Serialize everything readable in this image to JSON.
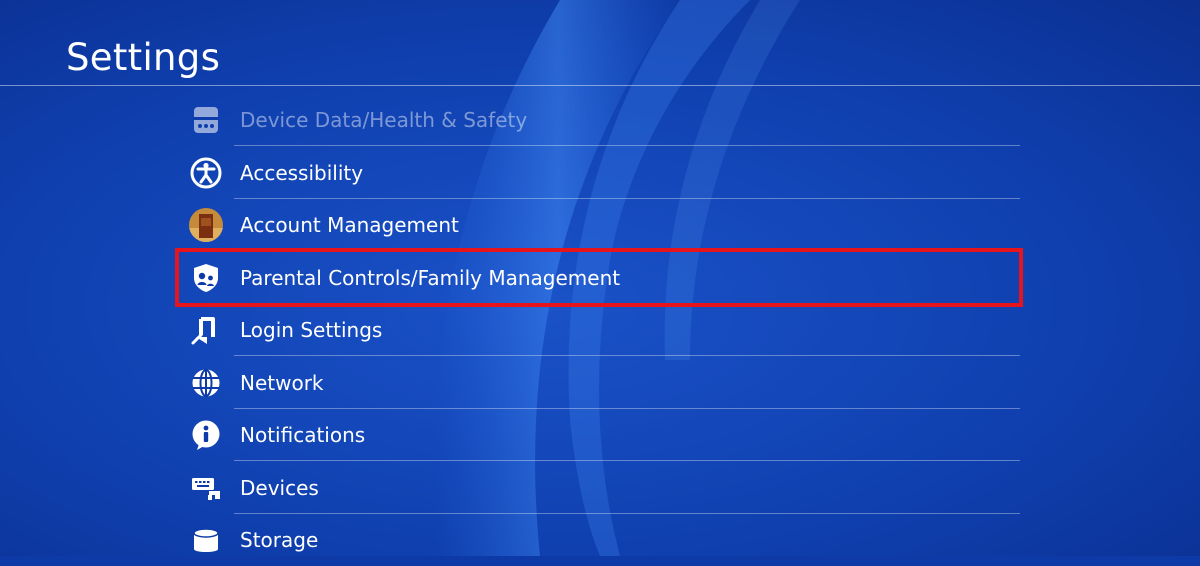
{
  "header": {
    "title": "Settings"
  },
  "menu": {
    "items": [
      {
        "label": "Device Data/Health & Safety",
        "icon": "device-data-icon",
        "state": "faded"
      },
      {
        "label": "Accessibility",
        "icon": "accessibility-icon",
        "state": "normal"
      },
      {
        "label": "Account Management",
        "icon": "account-avatar",
        "state": "normal"
      },
      {
        "label": "Parental Controls/Family Management",
        "icon": "parental-controls-icon",
        "state": "highlighted"
      },
      {
        "label": "Login Settings",
        "icon": "login-settings-icon",
        "state": "normal"
      },
      {
        "label": "Network",
        "icon": "globe-icon",
        "state": "normal"
      },
      {
        "label": "Notifications",
        "icon": "info-icon",
        "state": "normal"
      },
      {
        "label": "Devices",
        "icon": "devices-icon",
        "state": "normal"
      },
      {
        "label": "Storage",
        "icon": "storage-icon",
        "state": "normal"
      }
    ]
  },
  "theme": {
    "background": "#0d3aa6",
    "highlight_border": "#e8141b",
    "text": "#ffffff"
  }
}
